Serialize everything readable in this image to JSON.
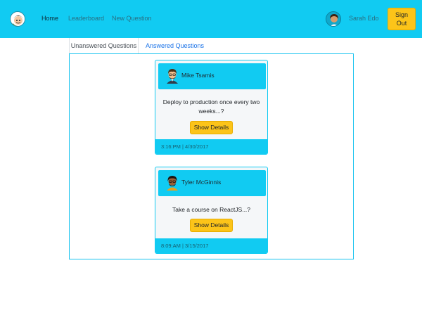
{
  "nav": {
    "links": [
      {
        "label": "Home",
        "active": true
      },
      {
        "label": "Leaderboard",
        "active": false
      },
      {
        "label": "New Question",
        "active": false
      }
    ],
    "user": {
      "name": "Sarah Edo"
    },
    "signout_label": "Sign Out",
    "logo_icon": "react-redux-logo-icon"
  },
  "tabs": [
    {
      "label": "Unanswered Questions",
      "active": true
    },
    {
      "label": "Answered Questions",
      "active": false
    }
  ],
  "questions": [
    {
      "author": "Mike Tsamis",
      "text": "Deploy to production once every two weeks...?",
      "button": "Show Details",
      "timestamp": "3:16:PM | 4/30/2017"
    },
    {
      "author": "Tyler McGinnis",
      "text": "Take a course on ReactJS...?",
      "button": "Show Details",
      "timestamp": "8:09:AM | 3/15/2017"
    }
  ],
  "colors": {
    "accent": "#11cbf2",
    "button": "#fcc419",
    "link": "#1a73e8"
  }
}
